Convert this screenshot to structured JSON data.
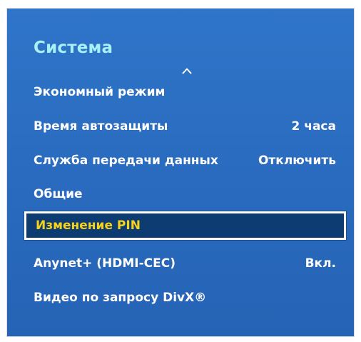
{
  "menu": {
    "title": "Система",
    "scroll_up_icon": "chevron-up-icon",
    "items": [
      {
        "label": "Экономный режим",
        "value": ""
      },
      {
        "label": "Время автозащиты",
        "value": "2 часа"
      },
      {
        "label": "Служба передачи данных",
        "value": "Отключить"
      },
      {
        "label": "Общие",
        "value": ""
      },
      {
        "label": "Изменение PIN",
        "value": ""
      },
      {
        "label": "Anynet+ (HDMI-CEC)",
        "value": "Вкл."
      },
      {
        "label": "Видео по запросу DivX®",
        "value": ""
      }
    ],
    "selected_index": 4,
    "colors": {
      "background": "#2a6cc0",
      "title": "#a8f0f5",
      "item_text": "#ffffff",
      "selected_background": "#0d3c73",
      "selected_text": "#f7d21a"
    }
  }
}
